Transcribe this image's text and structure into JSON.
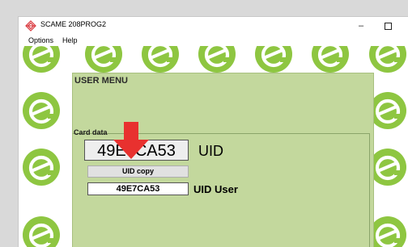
{
  "window": {
    "title": "SCAME 208PROG2",
    "minimize_glyph": "–",
    "app_icon": "scame-logo-icon"
  },
  "menubar": {
    "items": [
      {
        "label": "Options"
      },
      {
        "label": "Help"
      }
    ]
  },
  "panel": {
    "title": "USER MENU",
    "card_group": {
      "label": "Card data",
      "uid_value": "49E7CA53",
      "uid_label": "UID",
      "copy_button_label": "UID copy",
      "uid_user_value": "49E7CA53",
      "uid_user_label": "UID User"
    }
  },
  "colors": {
    "logo_green": "#8ec641",
    "panel_bg": "#c3d89d",
    "arrow_red": "#e8312f"
  },
  "icons": {
    "background_logo": "e-logo-icon",
    "pointer": "down-arrow-icon"
  }
}
